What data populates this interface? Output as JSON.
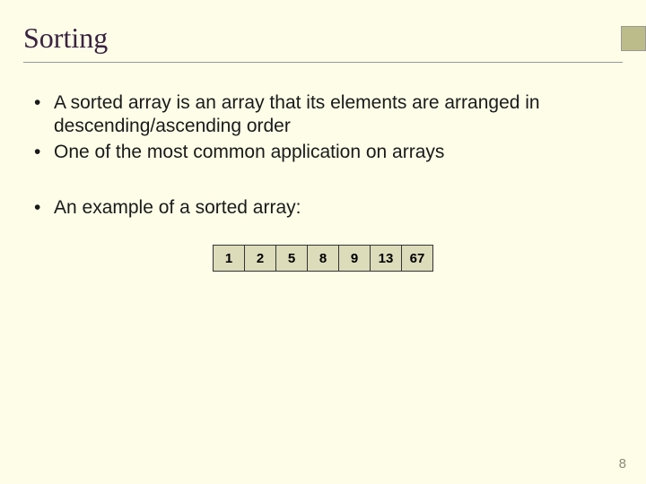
{
  "title": "Sorting",
  "bullets_a": [
    "A sorted array is an array that its elements are arranged in descending/ascending order",
    "One of the most common application on arrays"
  ],
  "bullets_b": [
    "An example of a sorted array:"
  ],
  "array": [
    "1",
    "2",
    "5",
    "8",
    "9",
    "13",
    "67"
  ],
  "page_number": "8"
}
